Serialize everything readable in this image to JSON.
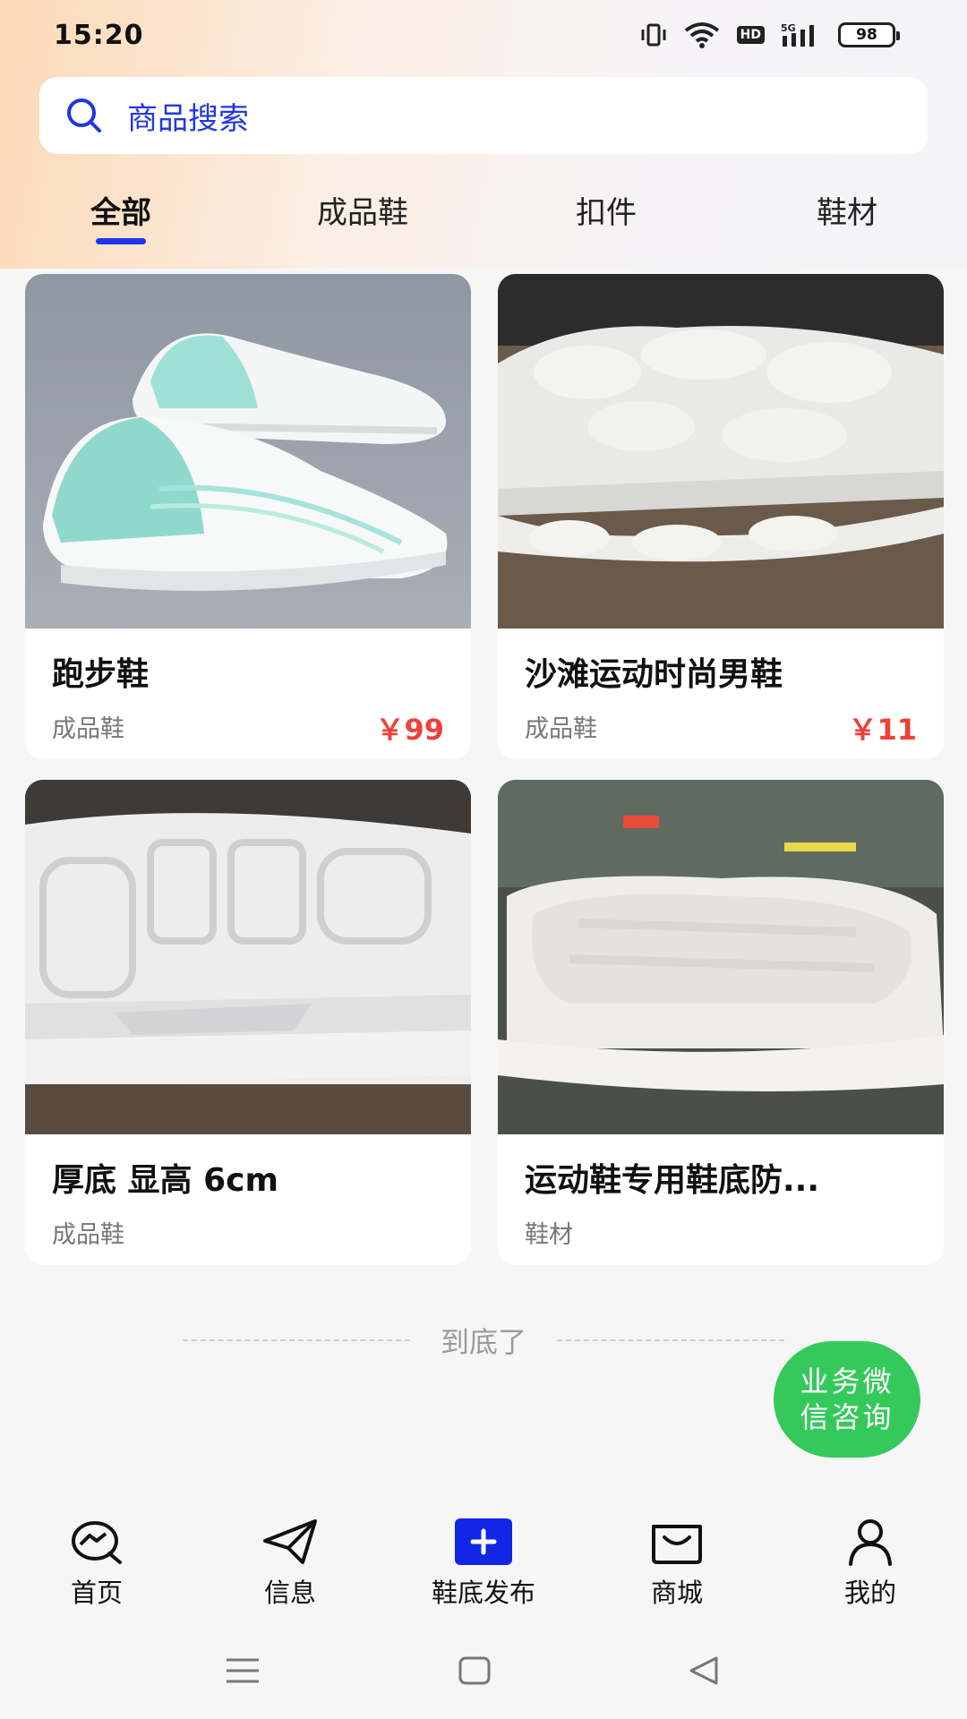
{
  "status_bar": {
    "time": "15:20",
    "battery": "98",
    "network": "5G",
    "hd_label": "HD"
  },
  "search": {
    "placeholder": "商品搜索"
  },
  "tabs": [
    {
      "label": "全部",
      "active": true
    },
    {
      "label": "成品鞋",
      "active": false
    },
    {
      "label": "扣件",
      "active": false
    },
    {
      "label": "鞋材",
      "active": false
    }
  ],
  "products": [
    {
      "title": "跑步鞋",
      "category": "成品鞋",
      "price": "￥99"
    },
    {
      "title": "沙滩运动时尚男鞋",
      "category": "成品鞋",
      "price": "￥11"
    },
    {
      "title": "厚底 显高 6cm",
      "category": "成品鞋",
      "price": ""
    },
    {
      "title": "运动鞋专用鞋底防...",
      "category": "鞋材",
      "price": ""
    }
  ],
  "end_text": "到底了",
  "consult_button": "业务微信咨询",
  "bottom_nav": [
    {
      "label": "首页",
      "icon": "home-icon"
    },
    {
      "label": "信息",
      "icon": "send-icon"
    },
    {
      "label": "鞋底发布",
      "icon": "publish-plus-icon"
    },
    {
      "label": "商城",
      "icon": "shopping-bag-icon"
    },
    {
      "label": "我的",
      "icon": "user-icon"
    }
  ],
  "colors": {
    "accent": "#1f36e6",
    "price": "#f0403a",
    "consult": "#35c95c"
  }
}
